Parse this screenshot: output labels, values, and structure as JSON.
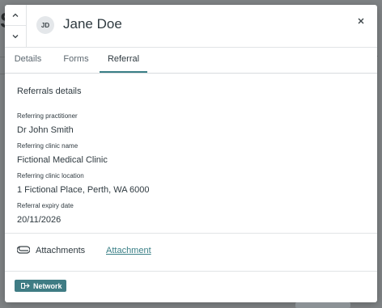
{
  "background": {
    "partial_title": "S",
    "partial_text": "v"
  },
  "header": {
    "avatar_initials": "JD",
    "name": "Jane Doe"
  },
  "tabs": [
    {
      "label": "Details",
      "active": false
    },
    {
      "label": "Forms",
      "active": false
    },
    {
      "label": "Referral",
      "active": true
    }
  ],
  "referral": {
    "section_title": "Referrals details",
    "fields": [
      {
        "label": "Referring practitioner",
        "value": "Dr John Smith"
      },
      {
        "label": "Referring clinic name",
        "value": "Fictional Medical Clinic"
      },
      {
        "label": "Referring clinic location",
        "value": "1 Fictional Place, Perth, WA 6000"
      },
      {
        "label": "Referral expiry date",
        "value": "20/11/2026"
      }
    ]
  },
  "attachments": {
    "label": "Attachments",
    "link": "Attachment"
  },
  "footer": {
    "network_button": "Network"
  },
  "colors": {
    "accent": "#3a7f86",
    "button": "#3f7c84",
    "text": "#2f3a40"
  },
  "icons": {
    "up": "chevron-up-icon",
    "down": "chevron-down-icon",
    "close": "close-icon",
    "attachment": "paperclip-icon",
    "network": "network-icon"
  }
}
